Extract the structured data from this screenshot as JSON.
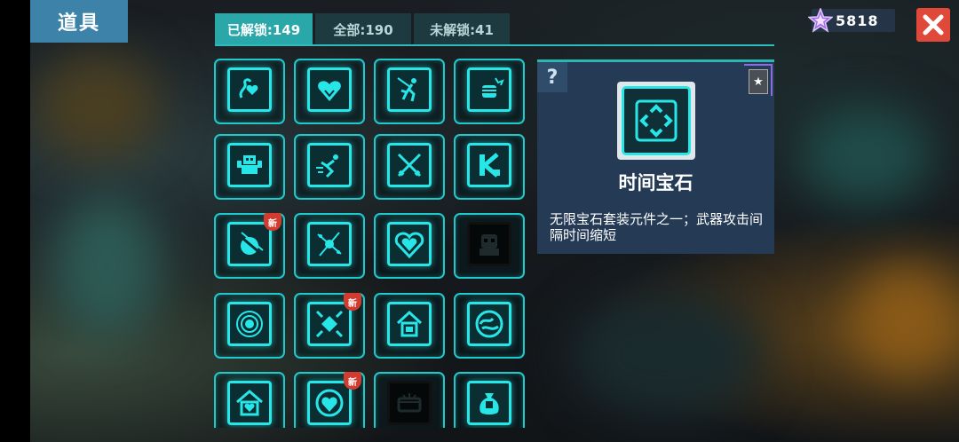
{
  "page": {
    "title": "道具"
  },
  "tabs": [
    {
      "label": "已解锁:149",
      "active": true
    },
    {
      "label": "全部:190",
      "active": false
    },
    {
      "label": "未解锁:41",
      "active": false
    }
  ],
  "currency": {
    "amount": "5818",
    "icon": "purple-star-icon"
  },
  "detail": {
    "help_label": "?",
    "name": "时间宝石",
    "description": "无限宝石套装元件之一；武器攻击间隔时间缩短"
  },
  "new_badge_label": "新",
  "items": [
    {
      "icon": "snake-heart-icon",
      "locked": false,
      "new": false
    },
    {
      "icon": "heart-burst-icon",
      "locked": false,
      "new": false
    },
    {
      "icon": "running-man-sword-icon",
      "locked": false,
      "new": false
    },
    {
      "icon": "fist-burst-icon",
      "locked": false,
      "new": false
    },
    {
      "icon": "robot-icon",
      "locked": false,
      "new": false
    },
    {
      "icon": "dash-man-icon",
      "locked": false,
      "new": false
    },
    {
      "icon": "crossed-swords-icon",
      "locked": false,
      "new": false
    },
    {
      "icon": "k-block-icon",
      "locked": false,
      "new": false
    },
    {
      "icon": "slash-orb-icon",
      "locked": false,
      "new": true
    },
    {
      "icon": "star-spark-icon",
      "locked": false,
      "new": false
    },
    {
      "icon": "heart-shield-icon",
      "locked": false,
      "new": false
    },
    {
      "icon": "skull-creature-icon",
      "locked": true,
      "new": false
    },
    {
      "icon": "ring-orb-icon",
      "locked": false,
      "new": false
    },
    {
      "icon": "diamond-arrows-icon",
      "locked": false,
      "new": true
    },
    {
      "icon": "house-box-icon",
      "locked": false,
      "new": false
    },
    {
      "icon": "circle-swirl-icon",
      "locked": false,
      "new": false
    },
    {
      "icon": "house-heart-icon",
      "locked": false,
      "new": false
    },
    {
      "icon": "heart-coin-icon",
      "locked": false,
      "new": true
    },
    {
      "icon": "chest-icon",
      "locked": true,
      "new": false
    },
    {
      "icon": "fortune-bag-icon",
      "locked": false,
      "new": false
    }
  ]
}
